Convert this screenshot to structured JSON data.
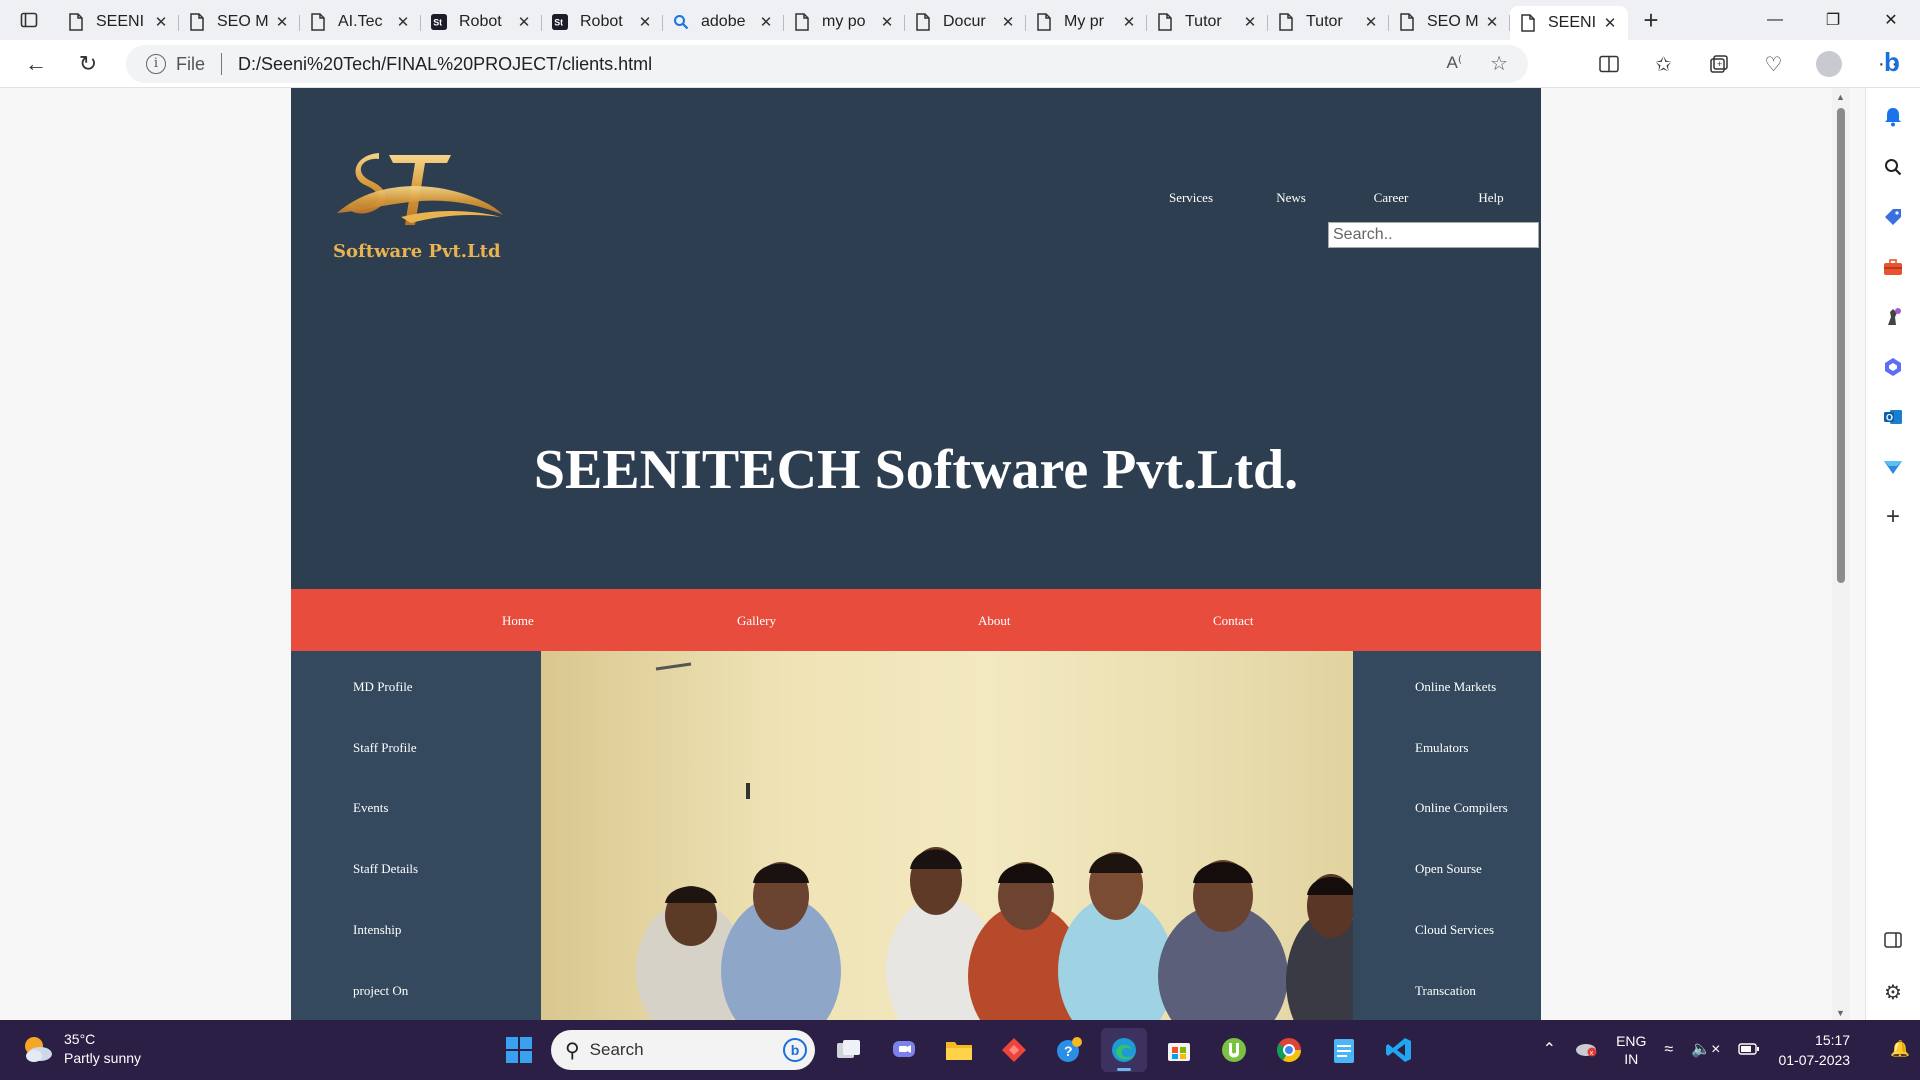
{
  "browser": {
    "tabs": [
      {
        "title": "SEENI",
        "icon": "page-icon"
      },
      {
        "title": "SEO M",
        "icon": "page-icon"
      },
      {
        "title": "AI.Tec",
        "icon": "page-icon"
      },
      {
        "title": "Robot",
        "icon": "st-icon"
      },
      {
        "title": "Robot",
        "icon": "st-icon"
      },
      {
        "title": "adobe",
        "icon": "search-icon"
      },
      {
        "title": "my po",
        "icon": "page-icon"
      },
      {
        "title": "Docur",
        "icon": "page-icon"
      },
      {
        "title": "My pr",
        "icon": "page-icon"
      },
      {
        "title": "Tutor",
        "icon": "page-icon"
      },
      {
        "title": "Tutor",
        "icon": "page-icon"
      },
      {
        "title": "SEO M",
        "icon": "page-icon"
      },
      {
        "title": "SEENI",
        "icon": "page-icon",
        "active": true
      }
    ],
    "address": {
      "scheme_label": "File",
      "url": "D:/Seeni%20Tech/FINAL%20PROJECT/clients.html"
    }
  },
  "site": {
    "logo_text": "Software Pvt.Ltd",
    "top_menu": [
      "Services",
      "News",
      "Career",
      "Help"
    ],
    "search_placeholder": "Search..",
    "hero_title": "SEENITECH Software Pvt.Ltd.",
    "main_nav": [
      "Home",
      "Gallery",
      "About",
      "Contact"
    ],
    "left_links": [
      "MD Profile",
      "Staff Profile",
      "Events",
      "Staff Details",
      "Intenship",
      "project On"
    ],
    "right_links": [
      "Online Markets",
      "Emulators",
      "Online Compilers",
      "Open Sourse",
      "Cloud Services",
      "Transcation"
    ],
    "colors": {
      "header_bg": "#2c3e50",
      "nav_bg": "#e74c3c",
      "sidebar_bg": "#34495e",
      "logo_gold": "#e9b350"
    }
  },
  "taskbar": {
    "weather": {
      "temp": "35°C",
      "desc": "Partly sunny"
    },
    "search_label": "Search",
    "lang": {
      "line1": "ENG",
      "line2": "IN"
    },
    "time": "15:17",
    "date": "01-07-2023"
  }
}
